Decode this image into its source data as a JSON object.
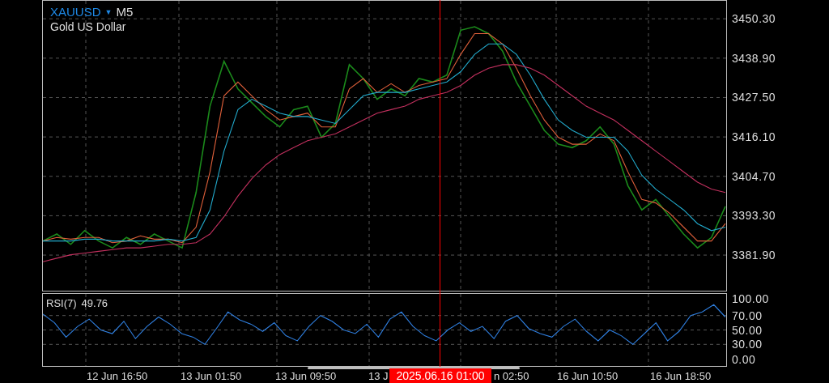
{
  "symbol": {
    "ticker": "XAUUSD",
    "dropdown": "▼",
    "timeframe": "M5",
    "name": "Gold US Dollar"
  },
  "price_chart": {
    "chart_data": {
      "type": "line",
      "grid": true,
      "ylim": [
        3371.6,
        3455.5
      ],
      "yticks": [
        {
          "value": 3450.3,
          "label": "3450.30"
        },
        {
          "value": 3438.9,
          "label": "3438.90"
        },
        {
          "value": 3427.5,
          "label": "3427.50"
        },
        {
          "value": 3416.1,
          "label": "3416.10"
        },
        {
          "value": 3404.7,
          "label": "3404.70"
        },
        {
          "value": 3393.3,
          "label": "3393.30"
        },
        {
          "value": 3381.9,
          "label": "3381.90"
        }
      ],
      "series": [
        {
          "color": "#1b8a1b",
          "values": [
            3386,
            3388,
            3385,
            3389,
            3386,
            3384,
            3387,
            3385,
            3388,
            3386,
            3384,
            3400,
            3425,
            3438,
            3430,
            3426,
            3422,
            3419,
            3424,
            3425,
            3416,
            3420,
            3437,
            3433,
            3427,
            3430,
            3428,
            3433,
            3432,
            3434,
            3447,
            3448,
            3446,
            3441,
            3432,
            3425,
            3418,
            3414,
            3413,
            3415,
            3419,
            3414,
            3402,
            3395,
            3398,
            3393,
            3388,
            3384,
            3387,
            3396
          ]
        },
        {
          "color": "#e0603a",
          "values": [
            3386,
            3387,
            3386.5,
            3387,
            3387,
            3385.5,
            3386,
            3387.5,
            3386.5,
            3386.5,
            3385.5,
            3390,
            3406,
            3428,
            3432,
            3428,
            3424,
            3421,
            3422,
            3423,
            3419,
            3419,
            3430,
            3433,
            3429,
            3431.5,
            3429,
            3431,
            3432,
            3433,
            3440,
            3446,
            3446,
            3443,
            3436,
            3428,
            3421,
            3416,
            3414,
            3414,
            3417,
            3415,
            3406,
            3398,
            3397,
            3394,
            3390,
            3386,
            3386,
            3391
          ]
        },
        {
          "color": "#22aacc",
          "values": [
            3386,
            3386,
            3386,
            3386.5,
            3386.5,
            3386,
            3386,
            3386,
            3386,
            3386.5,
            3386,
            3387,
            3395,
            3412,
            3424,
            3427,
            3425,
            3423,
            3422,
            3422,
            3421,
            3420,
            3424,
            3428,
            3429,
            3429,
            3429,
            3430,
            3431,
            3432,
            3435,
            3440,
            3443,
            3443,
            3440,
            3434,
            3427,
            3421,
            3418,
            3416,
            3416,
            3416,
            3412,
            3405,
            3401,
            3398,
            3395,
            3391,
            3389,
            3390
          ]
        },
        {
          "color": "#c2305e",
          "values": [
            3380,
            3381,
            3382,
            3382.5,
            3383,
            3383.5,
            3384,
            3384,
            3384.5,
            3385,
            3385,
            3385.5,
            3388,
            3393,
            3399,
            3404,
            3408,
            3411,
            3413,
            3415,
            3416,
            3417,
            3419,
            3421,
            3423,
            3424,
            3425,
            3427,
            3428,
            3429,
            3431,
            3434,
            3436,
            3437,
            3437,
            3436,
            3434,
            3431,
            3428,
            3425,
            3423,
            3421,
            3418,
            3415,
            3412,
            3409,
            3406,
            3403,
            3401,
            3400
          ]
        }
      ]
    }
  },
  "rsi_chart": {
    "indicator": {
      "label": "RSI(7)",
      "value": "49.76"
    },
    "chart_data": {
      "type": "line",
      "grid": true,
      "ylim": [
        0,
        100
      ],
      "yticks": [
        {
          "value": 100,
          "label": "100.00"
        },
        {
          "value": 70,
          "label": "70.00"
        },
        {
          "value": 50,
          "label": "50.00"
        },
        {
          "value": 30,
          "label": "30.00"
        },
        {
          "value": 0,
          "label": "0.00"
        }
      ],
      "series": [
        {
          "color": "#2f7fe0",
          "values": [
            72,
            60,
            40,
            55,
            65,
            50,
            45,
            62,
            38,
            55,
            68,
            58,
            45,
            40,
            30,
            52,
            75,
            64,
            58,
            48,
            60,
            42,
            35,
            55,
            70,
            62,
            50,
            45,
            58,
            40,
            65,
            75,
            55,
            42,
            35,
            50,
            60,
            48,
            55,
            38,
            62,
            70,
            52,
            45,
            40,
            55,
            65,
            48,
            35,
            50,
            42,
            30,
            45,
            60,
            35,
            48,
            70,
            75,
            85,
            68
          ]
        }
      ]
    }
  },
  "time_axis": [
    "12 Jun 16:50",
    "13 Jun 01:50",
    "13 Jun 09:50",
    "13 J",
    "n 02:50",
    "16 Jun 10:50",
    "16 Jun 18:50"
  ],
  "crosshair": {
    "label": "2025.06.16 01:00"
  }
}
